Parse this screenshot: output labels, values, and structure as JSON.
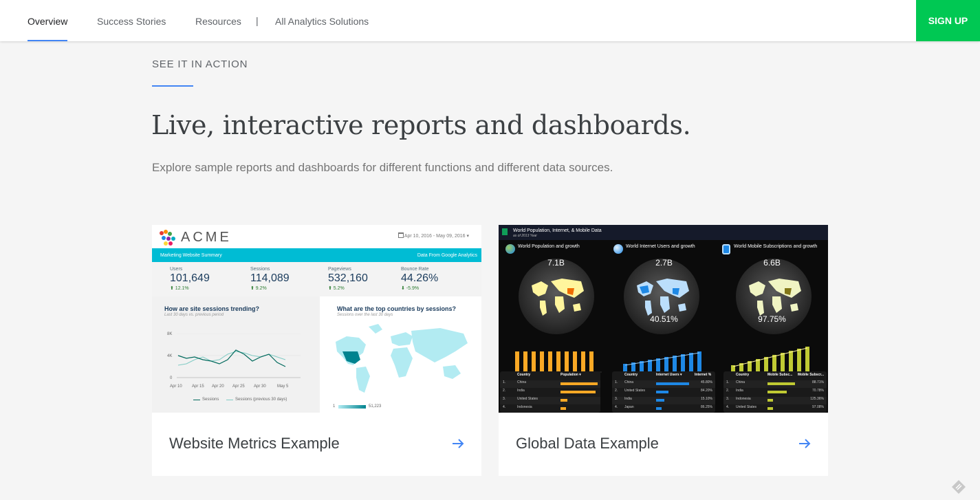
{
  "nav": {
    "items": [
      {
        "label": "Overview",
        "active": true
      },
      {
        "label": "Success Stories",
        "active": false
      },
      {
        "label": "Resources",
        "active": false
      },
      {
        "label": "All Analytics Solutions",
        "active": false
      }
    ],
    "separator": "|",
    "signup_label": "SIGN UP"
  },
  "hero": {
    "eyebrow": "SEE IT IN ACTION",
    "headline": "Live, interactive reports and dashboards.",
    "subhead": "Explore sample reports and dashboards for different functions and different data sources."
  },
  "colors": {
    "accent": "#4285f4",
    "signup_bg": "#00c853",
    "acme_bar": "#00bcd4"
  },
  "cards": [
    {
      "title": "Website Metrics Example",
      "thumb": {
        "logo": "ACME",
        "date_range": "Apr 10, 2016 - May 09, 2016 ▾",
        "bar_left": "Marketing Website Summary",
        "bar_right": "Data From Google Analytics",
        "kpis": [
          {
            "label": "Users",
            "value": "101,649",
            "change": "⬆ 12.1%"
          },
          {
            "label": "Sessions",
            "value": "114,089",
            "change": "⬆ 9.2%"
          },
          {
            "label": "Pageviews",
            "value": "532,160",
            "change": "⬆ 5.2%"
          },
          {
            "label": "Bounce Rate",
            "value": "44.26%",
            "change": "⬇ -5.9%"
          }
        ],
        "trend_title": "How are site sessions trending?",
        "trend_sub": "Last 30 days vs. previous period",
        "y_ticks": [
          "8K",
          "4K",
          "0"
        ],
        "x_ticks": [
          "Apr 10",
          "Apr 15",
          "Apr 20",
          "Apr 25",
          "Apr 30",
          "May 5"
        ],
        "legend": [
          "Sessions",
          "Sessions (previous 30 days)"
        ],
        "map_title": "What are the top countries by sessions?",
        "map_sub": "Sessions over the last 30 days",
        "map_scale_min": "1",
        "map_scale_max": "51,223"
      }
    },
    {
      "title": "Global Data Example",
      "thumb": {
        "header_title": "World Population, Internet, & Mobile Data",
        "header_sub": "as of 2013 Year",
        "columns": [
          {
            "title": "World Population and growth",
            "sub": "as of 2013",
            "big": "7.1B",
            "pct": ""
          },
          {
            "title": "World Internet Users and growth",
            "sub": "as of 2013",
            "big": "2.7B",
            "pct": "40.51%"
          },
          {
            "title": "World Mobile Subscriptions and growth",
            "sub": "as of 2013",
            "big": "6.6B",
            "pct": "97.75%"
          }
        ],
        "tables": [
          {
            "headers": [
              "Country",
              "Population ▾"
            ],
            "rows": [
              [
                "1.",
                "China"
              ],
              [
                "2.",
                "India"
              ],
              [
                "3.",
                "United States"
              ],
              [
                "4.",
                "Indonesia"
              ]
            ]
          },
          {
            "headers": [
              "Country",
              "Internet Users ▾",
              "Internet %"
            ],
            "rows": [
              [
                "1.",
                "China",
                "45.80%"
              ],
              [
                "2.",
                "United States",
                "84.20%"
              ],
              [
                "3.",
                "India",
                "15.10%"
              ],
              [
                "4.",
                "Japan",
                "86.25%"
              ]
            ]
          },
          {
            "headers": [
              "Country",
              "Mobile Subsc...",
              "Mobile Subscr..."
            ],
            "rows": [
              [
                "1.",
                "China",
                "88.71%"
              ],
              [
                "2.",
                "India",
                "70.78%"
              ],
              [
                "3.",
                "Indonesia",
                "125.36%"
              ],
              [
                "4.",
                "United States",
                "97.08%"
              ]
            ]
          }
        ]
      }
    }
  ]
}
